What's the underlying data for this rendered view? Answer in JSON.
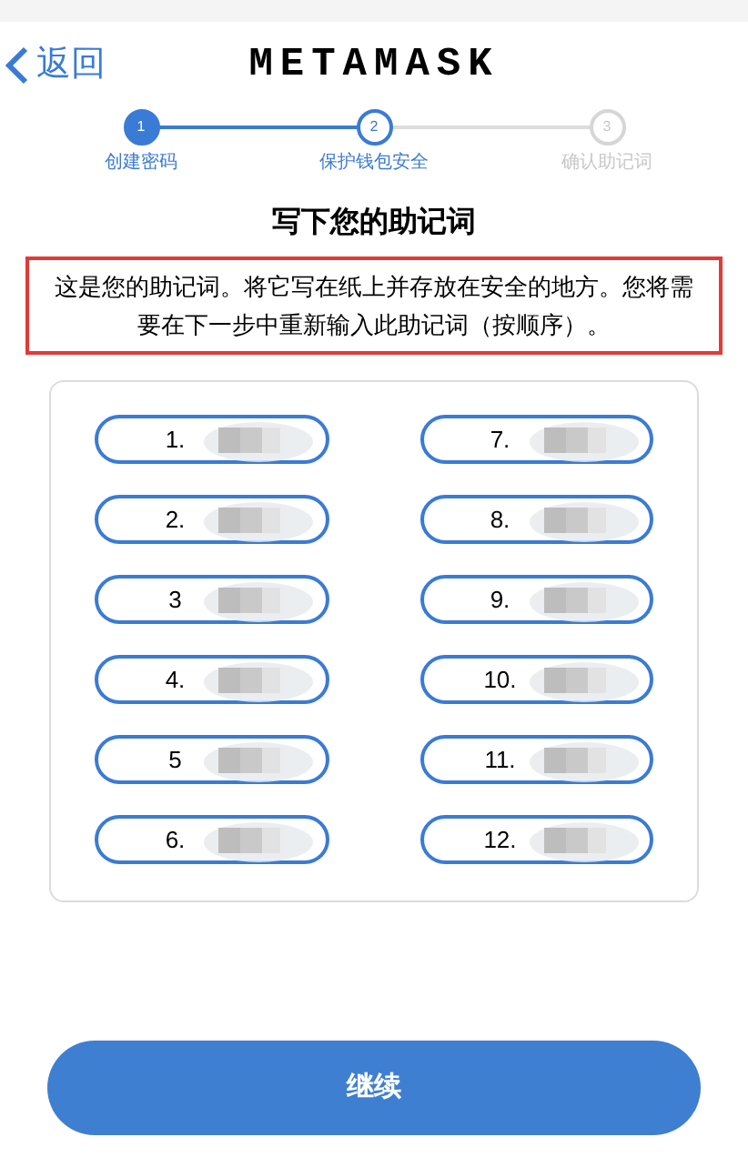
{
  "header": {
    "back": "返回",
    "title": "METAMASK"
  },
  "steps": [
    {
      "number": "1",
      "label": "创建密码",
      "done": true,
      "selected": false
    },
    {
      "number": "2",
      "label": "保护钱包安全",
      "done": false,
      "selected": true
    },
    {
      "number": "3",
      "label": "确认助记词",
      "done": false,
      "selected": false
    }
  ],
  "heading": "写下您的助记词",
  "notice": "这是您的助记词。将它写在纸上并存放在安全的地方。您将需要在下一步中重新输入此助记词（按顺序）。",
  "words": [
    {
      "index": "1."
    },
    {
      "index": "7."
    },
    {
      "index": "2."
    },
    {
      "index": "8."
    },
    {
      "index": "3"
    },
    {
      "index": "9."
    },
    {
      "index": "4."
    },
    {
      "index": "10."
    },
    {
      "index": "5"
    },
    {
      "index": "11."
    },
    {
      "index": "6."
    },
    {
      "index": "12."
    }
  ],
  "continue_button": "继续"
}
